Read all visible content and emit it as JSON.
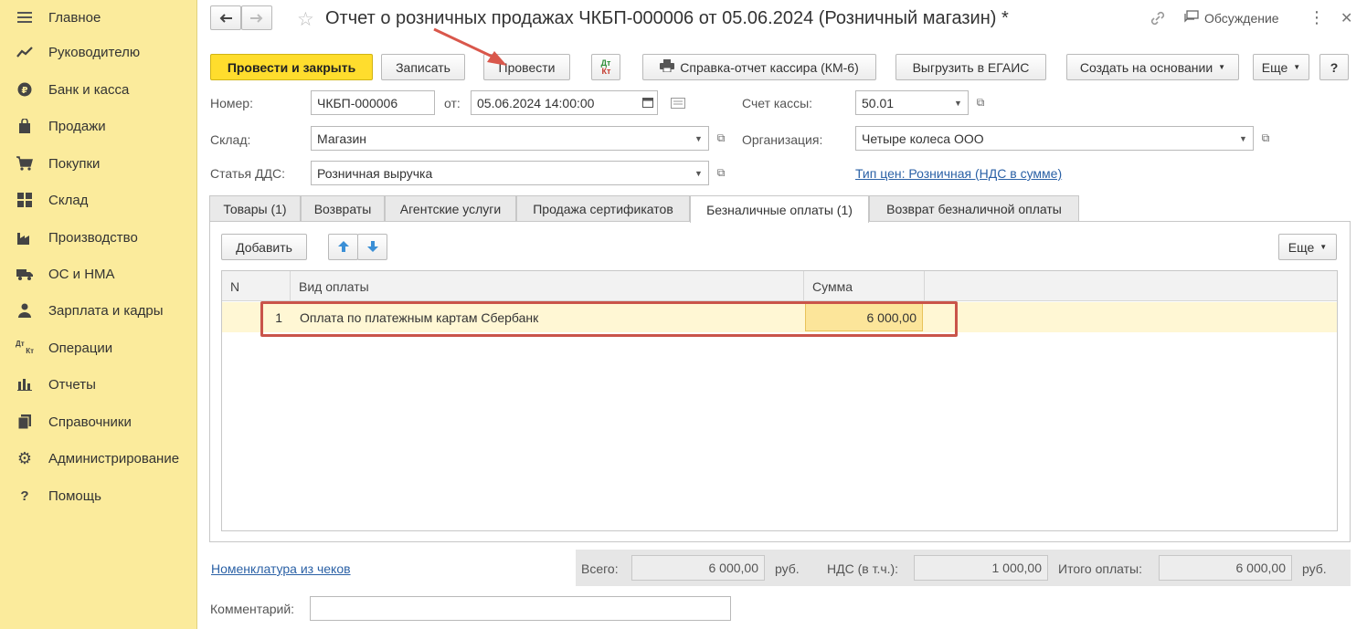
{
  "sidebar": {
    "items": [
      {
        "label": "Главное",
        "icon": "menu-icon"
      },
      {
        "label": "Руководителю",
        "icon": "trend-icon"
      },
      {
        "label": "Банк и касса",
        "icon": "coin-icon"
      },
      {
        "label": "Продажи",
        "icon": "bag-icon"
      },
      {
        "label": "Покупки",
        "icon": "cart-icon"
      },
      {
        "label": "Склад",
        "icon": "warehouse-icon"
      },
      {
        "label": "Производство",
        "icon": "factory-icon"
      },
      {
        "label": "ОС и НМА",
        "icon": "truck-icon"
      },
      {
        "label": "Зарплата и кадры",
        "icon": "person-icon"
      },
      {
        "label": "Операции",
        "icon": "dt-kt-icon"
      },
      {
        "label": "Отчеты",
        "icon": "bar-chart-icon"
      },
      {
        "label": "Справочники",
        "icon": "books-icon"
      },
      {
        "label": "Администрирование",
        "icon": "gear-icon"
      },
      {
        "label": "Помощь",
        "icon": "question-icon"
      }
    ]
  },
  "header": {
    "title": "Отчет о розничных продажах ЧКБП-000006 от 05.06.2024 (Розничный магазин) *",
    "discussion_label": "Обсуждение",
    "more_glyph": "⋮",
    "close_glyph": "✕"
  },
  "toolbar": {
    "post_close": "Провести и закрыть",
    "save": "Записать",
    "post": "Провести",
    "dt_kt_top": "Дт",
    "dt_kt_bottom": "Кт",
    "cashier_report": "Справка-отчет кассира (КМ-6)",
    "egais": "Выгрузить в ЕГАИС",
    "create_based": "Создать на основании",
    "more": "Еще",
    "help": "?"
  },
  "form": {
    "number_label": "Номер:",
    "number_value": "ЧКБП-000006",
    "from_label": "от:",
    "date_value": "05.06.2024 14:00:00",
    "cash_account_label": "Счет кассы:",
    "cash_account_value": "50.01",
    "warehouse_label": "Склад:",
    "warehouse_value": "Магазин",
    "org_label": "Организация:",
    "org_value": "Четыре колеса ООО",
    "dds_label": "Статья ДДС:",
    "dds_value": "Розничная выручка",
    "price_type_link": "Тип цен: Розничная (НДС в сумме)"
  },
  "tabs": [
    {
      "label": "Товары (1)"
    },
    {
      "label": "Возвраты"
    },
    {
      "label": "Агентские услуги"
    },
    {
      "label": "Продажа сертификатов"
    },
    {
      "label": "Безналичные оплаты (1)"
    },
    {
      "label": "Возврат безналичной оплаты"
    }
  ],
  "table_toolbar": {
    "add": "Добавить",
    "more": "Еще"
  },
  "table": {
    "columns": [
      "N",
      "Вид оплаты",
      "Сумма"
    ],
    "rows": [
      {
        "n": "1",
        "payment_type": "Оплата по платежным картам Сбербанк",
        "amount": "6 000,00"
      }
    ]
  },
  "footer": {
    "nomenclature_link": "Номенклатура из чеков",
    "total_label": "Всего:",
    "total_value": "6 000,00",
    "currency": "руб.",
    "vat_label": "НДС (в т.ч.):",
    "vat_value": "1 000,00",
    "payment_total_label": "Итого оплаты:",
    "payment_total_value": "6 000,00",
    "comment_label": "Комментарий:",
    "comment_value": ""
  },
  "colors": {
    "sidebar_bg": "#fbeb9c",
    "primary_button": "#ffdd2d",
    "selected_row": "#fff7d4",
    "highlight_border": "#c9544a",
    "link": "#2b61a6"
  }
}
